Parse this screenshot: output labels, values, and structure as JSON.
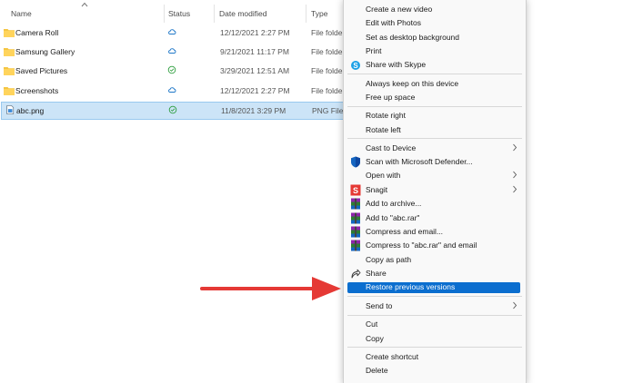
{
  "columns": {
    "name": "Name",
    "status": "Status",
    "date": "Date modified",
    "type": "Type"
  },
  "files": [
    {
      "name": "Camera Roll",
      "status": "cloud",
      "date": "12/12/2021 2:27 PM",
      "type": "File folder",
      "kind": "folder"
    },
    {
      "name": "Samsung Gallery",
      "status": "cloud",
      "date": "9/21/2021 11:17 PM",
      "type": "File folder",
      "kind": "folder"
    },
    {
      "name": "Saved Pictures",
      "status": "synced",
      "date": "3/29/2021 12:51 AM",
      "type": "File folder",
      "kind": "folder"
    },
    {
      "name": "Screenshots",
      "status": "cloud",
      "date": "12/12/2021 2:27 PM",
      "type": "File folder",
      "kind": "folder"
    },
    {
      "name": "abc.png",
      "status": "synced",
      "date": "11/8/2021 3:29 PM",
      "type": "PNG File",
      "kind": "png",
      "selected": true
    }
  ],
  "context_menu": [
    "Create a new video",
    "Edit with Photos",
    "Set as desktop background",
    "Print",
    "Share with Skype",
    "Always keep on this device",
    "Free up space",
    "Rotate right",
    "Rotate left",
    "Cast to Device",
    "Scan with Microsoft Defender...",
    "Open with",
    "Snagit",
    "Add to archive...",
    "Add to \"abc.rar\"",
    "Compress and email...",
    "Compress to \"abc.rar\" and email",
    "Copy as path",
    "Share",
    "Restore previous versions",
    "Send to",
    "Cut",
    "Copy",
    "Create shortcut",
    "Delete"
  ],
  "highlighted_item": "Restore previous versions",
  "colors": {
    "accent": "#0b6ecf",
    "selection": "#cce4f7",
    "folder": "#f5c542",
    "arrow": "#e53935",
    "cloud": "#1e77c8",
    "synced": "#2e9e3e"
  }
}
